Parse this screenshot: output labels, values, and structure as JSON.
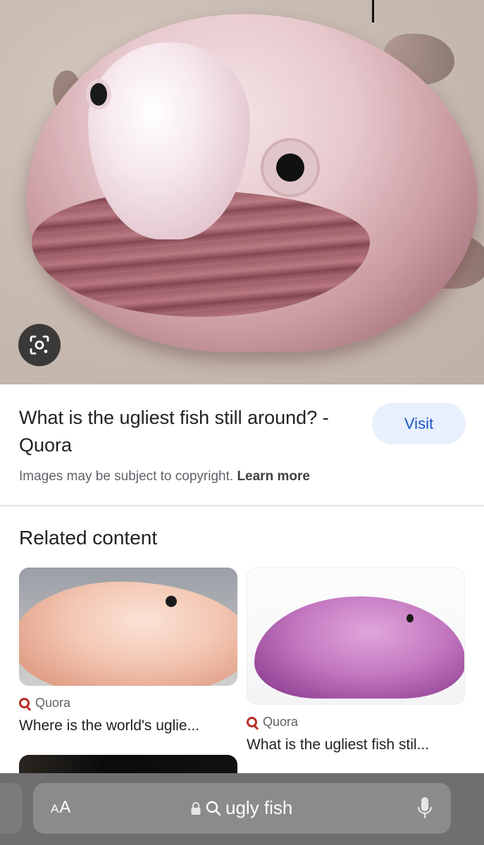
{
  "hero": {
    "lens_icon": "google-lens-icon"
  },
  "result": {
    "title": "What is the ugliest fish still around? - Quora",
    "visit_label": "Visit",
    "copyright_text": "Images may be subject to copyright.",
    "learn_more": "Learn more"
  },
  "related": {
    "heading": "Related content",
    "cards": [
      {
        "source": "Quora",
        "title": "Where is the world's uglie..."
      },
      {
        "source": "Quora",
        "title": "What is the ugliest fish stil..."
      }
    ]
  },
  "browser": {
    "text_size_label_big": "A",
    "text_size_label_small": "A",
    "url_text": "ugly fish",
    "icons": [
      "lock-icon",
      "search-icon",
      "microphone-icon"
    ]
  },
  "colors": {
    "visit_bg": "#e8f0fe",
    "visit_text": "#1a56c4",
    "quora_red": "#b92b27",
    "toolbar_bg": "#6f6f71"
  }
}
